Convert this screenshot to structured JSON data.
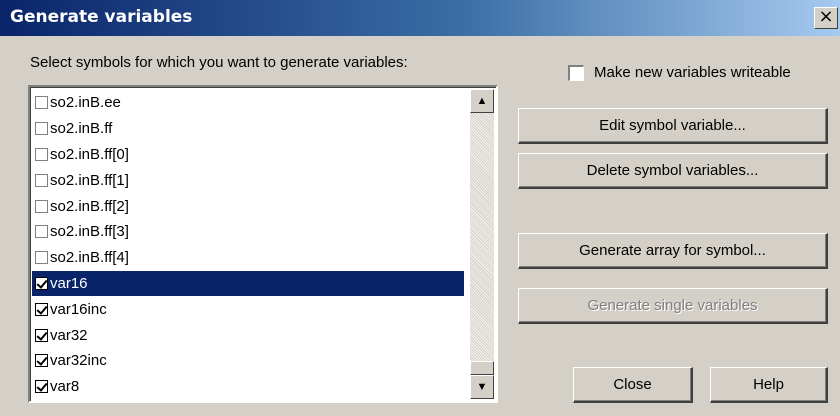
{
  "window": {
    "title": "Generate variables",
    "close_glyph": "×"
  },
  "list": {
    "label": "Select symbols for which you want to generate variables:",
    "items": [
      {
        "label": "so2.inB.ee",
        "checked": false,
        "selected": false
      },
      {
        "label": "so2.inB.ff",
        "checked": false,
        "selected": false
      },
      {
        "label": "so2.inB.ff[0]",
        "checked": false,
        "selected": false
      },
      {
        "label": "so2.inB.ff[1]",
        "checked": false,
        "selected": false
      },
      {
        "label": "so2.inB.ff[2]",
        "checked": false,
        "selected": false
      },
      {
        "label": "so2.inB.ff[3]",
        "checked": false,
        "selected": false
      },
      {
        "label": "so2.inB.ff[4]",
        "checked": false,
        "selected": false
      },
      {
        "label": "var16",
        "checked": true,
        "selected": true
      },
      {
        "label": "var16inc",
        "checked": true,
        "selected": false
      },
      {
        "label": "var32",
        "checked": true,
        "selected": false
      },
      {
        "label": "var32inc",
        "checked": true,
        "selected": false
      },
      {
        "label": "var8",
        "checked": true,
        "selected": false
      }
    ],
    "scroll_up_glyph": "▲",
    "scroll_down_glyph": "▼"
  },
  "options": {
    "writeable_label": "Make new variables writeable",
    "writeable_checked": false
  },
  "buttons": {
    "edit": "Edit symbol variable...",
    "delete": "Delete symbol variables...",
    "array": "Generate array for symbol...",
    "single": "Generate single variables",
    "close": "Close",
    "help": "Help"
  },
  "colors": {
    "selection": "#0a246a",
    "titlebar_start": "#0a246a",
    "dialog_face": "#d4d0c8"
  }
}
